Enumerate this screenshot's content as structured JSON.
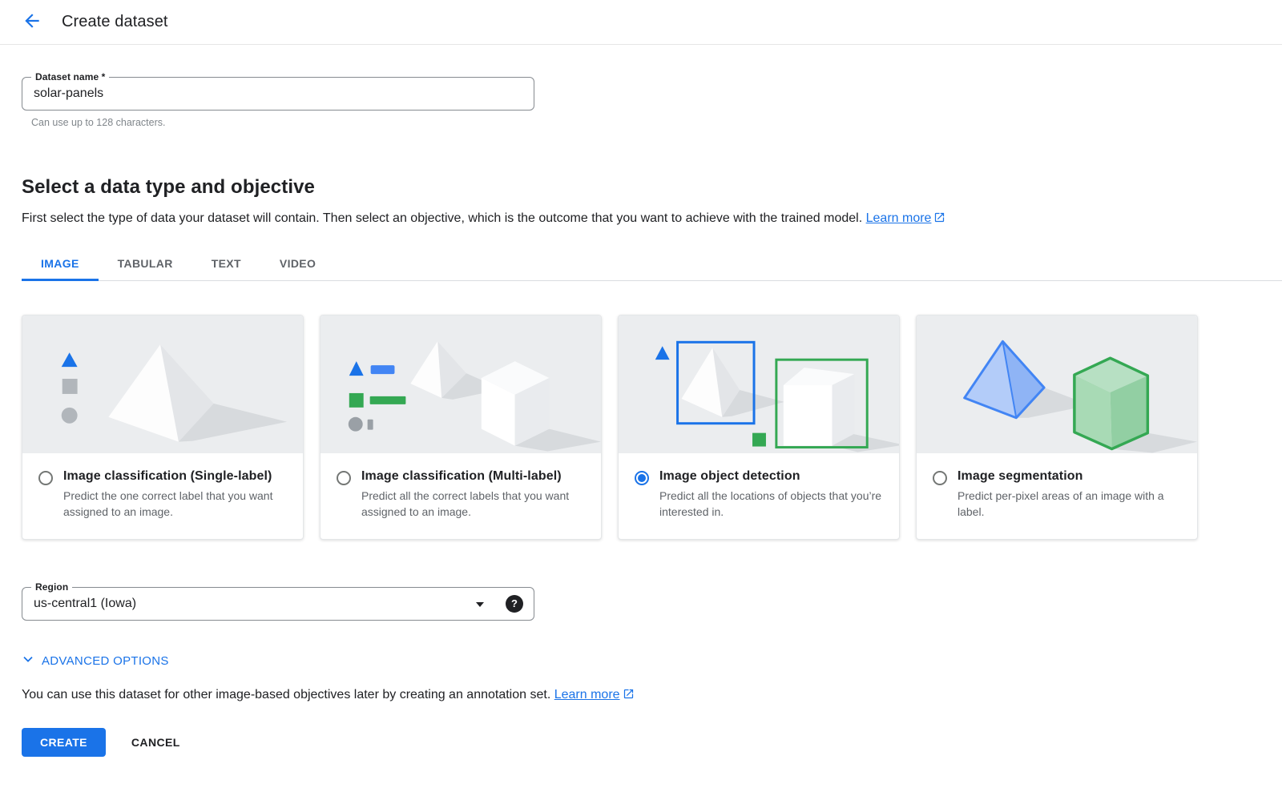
{
  "header": {
    "title": "Create dataset"
  },
  "dataset_name_field": {
    "label": "Dataset name *",
    "value": "solar-panels",
    "helper": "Can use up to 128 characters."
  },
  "section": {
    "heading": "Select a data type and objective",
    "description": "First select the type of data your dataset will contain. Then select an objective, which is the outcome that you want to achieve with the trained model.",
    "learn_more_label": "Learn more"
  },
  "tabs": [
    {
      "label": "IMAGE",
      "active": true
    },
    {
      "label": "TABULAR",
      "active": false
    },
    {
      "label": "TEXT",
      "active": false
    },
    {
      "label": "VIDEO",
      "active": false
    }
  ],
  "objectives": [
    {
      "title": "Image classification (Single-label)",
      "description": "Predict the one correct label that you want assigned to an image.",
      "selected": false,
      "illustration": "single-label-shapes"
    },
    {
      "title": "Image classification (Multi-label)",
      "description": "Predict all the correct labels that you want assigned to an image.",
      "selected": false,
      "illustration": "multi-label-shapes"
    },
    {
      "title": "Image object detection",
      "description": "Predict all the locations of objects that you’re interested in.",
      "selected": true,
      "illustration": "bounding-boxes"
    },
    {
      "title": "Image segmentation",
      "description": "Predict per-pixel areas of an image with a label.",
      "selected": false,
      "illustration": "colored-shapes"
    }
  ],
  "region_field": {
    "label": "Region",
    "value": "us-central1 (Iowa)"
  },
  "advanced_options": {
    "label": "ADVANCED OPTIONS"
  },
  "footer_note": {
    "text": "You can use this dataset for other image-based objectives later by creating an annotation set.",
    "learn_more_label": "Learn more"
  },
  "actions": {
    "create_label": "CREATE",
    "cancel_label": "CANCEL"
  },
  "icons": {
    "help_glyph": "?"
  },
  "colors": {
    "accent": "#1a73e8",
    "green": "#34a853",
    "text": "#202124",
    "muted": "#5f6368"
  }
}
